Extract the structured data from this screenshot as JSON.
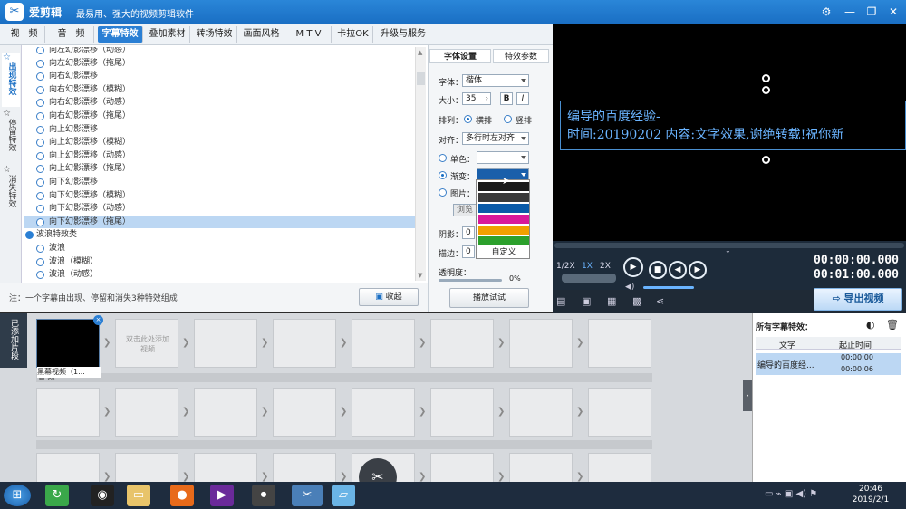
{
  "app": {
    "name": "爱剪辑",
    "slogan": "最易用、强大的视频剪辑软件"
  },
  "menu_tabs": [
    "视　频",
    "音　频",
    "字幕特效",
    "叠加素材",
    "转场特效",
    "画面风格",
    "M T V",
    "卡拉OK",
    "升级与服务"
  ],
  "active_tab": "字幕特效",
  "side_tabs": [
    "出现特效",
    "停留特效",
    "消失特效"
  ],
  "effects": [
    {
      "label": "向左幻影漂移（动感）",
      "type": "item"
    },
    {
      "label": "向左幻影漂移（拖尾）",
      "type": "item"
    },
    {
      "label": "向右幻影漂移",
      "type": "item"
    },
    {
      "label": "向右幻影漂移（模糊）",
      "type": "item"
    },
    {
      "label": "向右幻影漂移（动感）",
      "type": "item"
    },
    {
      "label": "向右幻影漂移（拖尾）",
      "type": "item"
    },
    {
      "label": "向上幻影漂移",
      "type": "item"
    },
    {
      "label": "向上幻影漂移（模糊）",
      "type": "item"
    },
    {
      "label": "向上幻影漂移（动感）",
      "type": "item"
    },
    {
      "label": "向上幻影漂移（拖尾）",
      "type": "item"
    },
    {
      "label": "向下幻影漂移",
      "type": "item"
    },
    {
      "label": "向下幻影漂移（模糊）",
      "type": "item"
    },
    {
      "label": "向下幻影漂移（动感）",
      "type": "item"
    },
    {
      "label": "向下幻影漂移（拖尾）",
      "type": "selected"
    },
    {
      "label": "波浪特效类",
      "type": "category"
    },
    {
      "label": "波浪",
      "type": "item"
    },
    {
      "label": "波浪（模糊）",
      "type": "item"
    },
    {
      "label": "波浪（动感）",
      "type": "item"
    }
  ],
  "note": "注：一个字幕由出现、停留和消失3种特效组成",
  "collapse_label": "收起",
  "font_panel": {
    "tabs": [
      "字体设置",
      "特效参数"
    ],
    "font_label": "字体：",
    "font_value": "楷体",
    "size_label": "大小：",
    "size_value": "35",
    "bold": "B",
    "italic": "I",
    "arrange_label": "排列：",
    "arrange_h": "横排",
    "arrange_v": "竖排",
    "align_label": "对齐：",
    "align_value": "多行时左对齐",
    "solid_label": "单色：",
    "gradient_label": "渐变：",
    "image_label": "图片：",
    "browse_label": "浏览",
    "shadow_label": "阴影：",
    "shadow_value": "0",
    "stroke_label": "描边：",
    "stroke_value": "0",
    "opacity_label": "透明度：",
    "opacity_value": "0%",
    "custom_label": "自定义",
    "play_test": "播放试试"
  },
  "gradient_colors": [
    "#1a1a1a",
    "#3a3a3a",
    "#0a5aa8",
    "#d8189a",
    "#f0a000",
    "#2ca02c"
  ],
  "preview": {
    "line1": "编导的百度经验-",
    "line2": "时间:20190202 内容:文字效果,谢绝转载!祝你新"
  },
  "player": {
    "speeds": [
      "1/2X",
      "1X",
      "2X"
    ],
    "current_time": "00:00:00.000",
    "total_time": "00:01:00.000",
    "export_label": "导出视频"
  },
  "timeline": {
    "added_label": "已添加片段",
    "clip_name": "黑幕视频（1...",
    "add_hint": "双击此处添加视频",
    "audio_label": "音 频"
  },
  "subtitle_list": {
    "title": "所有字幕特效：",
    "col_text": "文字",
    "col_time": "起止时间",
    "row_text": "编导的百度经...",
    "row_start": "00:00:00",
    "row_end": "00:00:06"
  },
  "clock": {
    "time": "20:46",
    "date": "2019/2/1"
  }
}
